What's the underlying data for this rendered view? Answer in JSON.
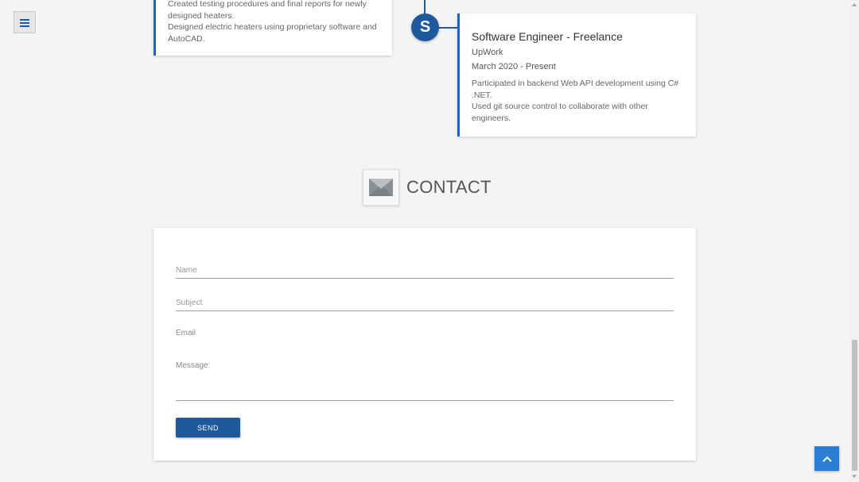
{
  "nav": {
    "menu_icon": "hamburger-menu-icon"
  },
  "timeline": {
    "previous_card": {
      "lines": [
        "Created testing procedures and final reports for newly designed heaters.",
        "Designed electric heaters using proprietary software and AutoCAD."
      ]
    },
    "current_entry": {
      "dot_letter": "S",
      "title": "Software Engineer - Freelance",
      "company": "UpWork",
      "date": "March 2020 - Present",
      "lines": [
        "Participated in backend Web API development using C# .NET.",
        "Used git source control to collaborate with other engineers."
      ]
    }
  },
  "contact": {
    "title": "CONTACT",
    "icon": "envelope-icon",
    "form": {
      "name_placeholder": "Name",
      "subject_placeholder": "Subject",
      "email_label": "Email",
      "message_label": "Message",
      "send_label": "SEND"
    }
  },
  "back_to_top": {
    "icon": "chevron-up-icon"
  },
  "colors": {
    "primary": "#1e5a9b",
    "accent_border": "#1e64c8",
    "back_to_top": "#2a7fd4",
    "background": "#f4f4f4"
  }
}
